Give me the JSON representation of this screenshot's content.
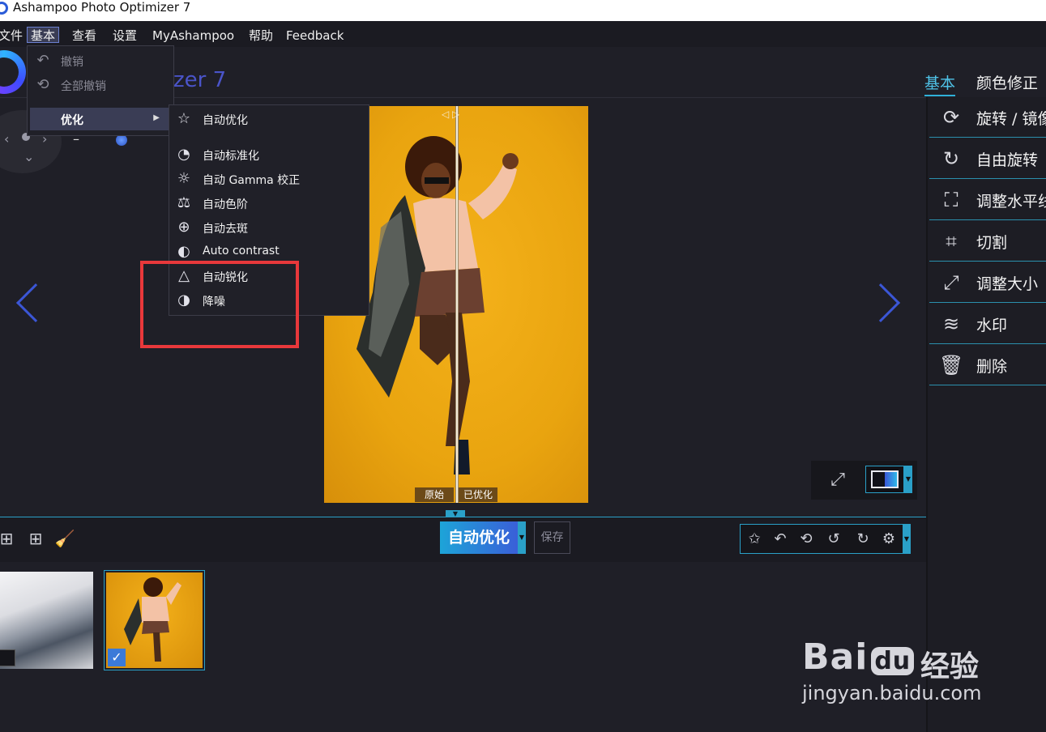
{
  "window": {
    "title": "Ashampoo Photo Optimizer 7"
  },
  "menubar": {
    "items": [
      "文件",
      "基本",
      "查看",
      "设置",
      "MyAshampoo",
      "帮助",
      "Feedback"
    ]
  },
  "brand": {
    "fragment": "zer 7"
  },
  "tabs": {
    "basic": "基本",
    "color": "颜色修正"
  },
  "right_panel": [
    {
      "icon": "rotate-mirror-icon",
      "label": "旋转 / 镜像"
    },
    {
      "icon": "free-rotate-icon",
      "label": "自由旋转"
    },
    {
      "icon": "level-horizon-icon",
      "label": "调整水平线"
    },
    {
      "icon": "crop-icon",
      "label": "切割"
    },
    {
      "icon": "resize-icon",
      "label": "调整大小"
    },
    {
      "icon": "watermark-icon",
      "label": "水印"
    },
    {
      "icon": "trash-icon",
      "label": "删除"
    }
  ],
  "basic_menu": {
    "undo": "撤销",
    "undo_all": "全部撤销",
    "optimize": "优化"
  },
  "optimize_submenu": [
    {
      "icon": "star-icon",
      "label": "自动优化"
    },
    {
      "icon": "normalize-icon",
      "label": "自动标准化"
    },
    {
      "icon": "gamma-icon",
      "label": "自动 Gamma 校正"
    },
    {
      "icon": "levels-icon",
      "label": "自动色阶"
    },
    {
      "icon": "despeckle-icon",
      "label": "自动去斑"
    },
    {
      "icon": "contrast-icon",
      "label": "Auto contrast"
    },
    {
      "icon": "sharpen-icon",
      "label": "自动锐化"
    },
    {
      "icon": "denoise-icon",
      "label": "降噪"
    }
  ],
  "compare": {
    "original": "原始",
    "optimized": "已优化"
  },
  "toolbar": {
    "auto_optimize": "自动优化",
    "save": "保存"
  },
  "watermark": {
    "bai": "Bai",
    "du": "du",
    "cn": "经验",
    "url": "jingyan.baidu.com"
  }
}
